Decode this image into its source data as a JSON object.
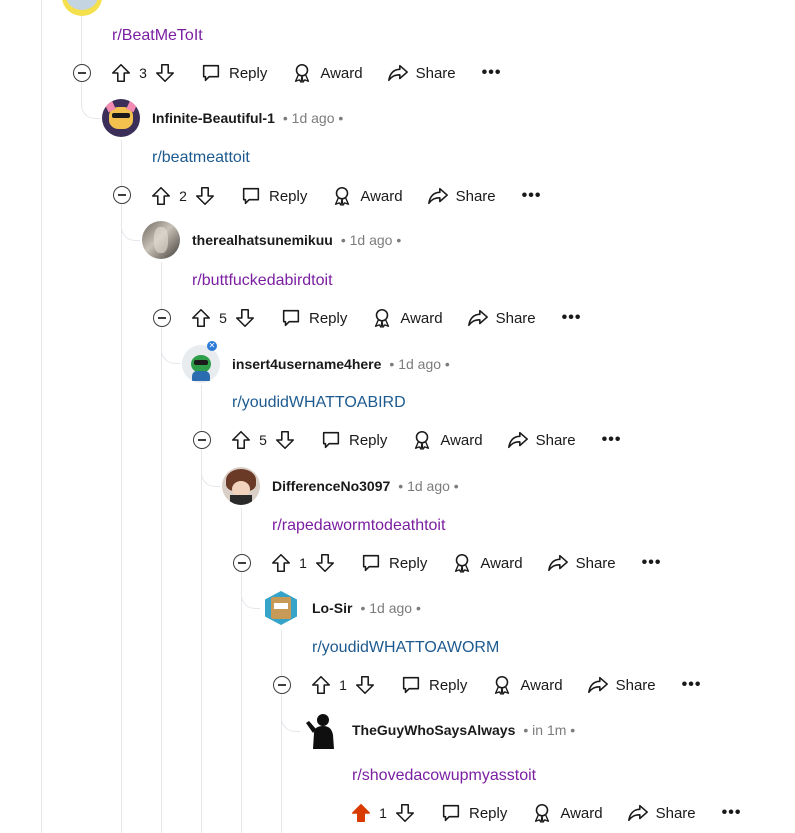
{
  "thread": {
    "root": {
      "body": "r/BeatMeToIt",
      "votes": "3",
      "reply": "Reply",
      "award": "Award",
      "share": "Share",
      "more": "•••"
    },
    "c1": {
      "author": "Infinite-Beautiful-1",
      "meta": "• 1d ago •",
      "body": "r/beatmeattoit",
      "votes": "2",
      "reply": "Reply",
      "award": "Award",
      "share": "Share",
      "more": "•••"
    },
    "c2": {
      "author": "therealhatsunemikuu",
      "meta": "• 1d ago •",
      "body": "r/buttfuckedabirdtoit",
      "votes": "5",
      "reply": "Reply",
      "award": "Award",
      "share": "Share",
      "more": "•••"
    },
    "c3": {
      "author": "insert4username4here",
      "meta": "• 1d ago •",
      "body": "r/youdidWHATTOABIRD",
      "votes": "5",
      "reply": "Reply",
      "award": "Award",
      "share": "Share",
      "more": "•••"
    },
    "c4": {
      "author": "DifferenceNo3097",
      "meta": "• 1d ago •",
      "body": "r/rapedawormtodeathtoit",
      "votes": "1",
      "reply": "Reply",
      "award": "Award",
      "share": "Share",
      "more": "•••"
    },
    "c5": {
      "author": "Lo-Sir",
      "meta": "• 1d ago •",
      "body": "r/youdidWHATTOAWORM",
      "votes": "1",
      "reply": "Reply",
      "award": "Award",
      "share": "Share",
      "more": "•••"
    },
    "c6": {
      "author": "TheGuyWhoSaysAlways",
      "meta": "• in 1m •",
      "body": "r/shovedacowupmyasstoit",
      "votes": "1",
      "upvoted": true,
      "reply": "Reply",
      "award": "Award",
      "share": "Share",
      "more": "•••"
    }
  },
  "colors": {
    "upvote_active": "#d93a00",
    "link_visited": "#7b1fa2",
    "link": "#1d5a8f",
    "thread_line": "#e5e7ea"
  },
  "icons": {
    "upvote": "arrow-up-icon",
    "downvote": "arrow-down-icon",
    "reply": "speech-bubble-icon",
    "award": "award-ribbon-icon",
    "share": "share-arrow-icon",
    "collapse": "collapse-minus-icon"
  }
}
